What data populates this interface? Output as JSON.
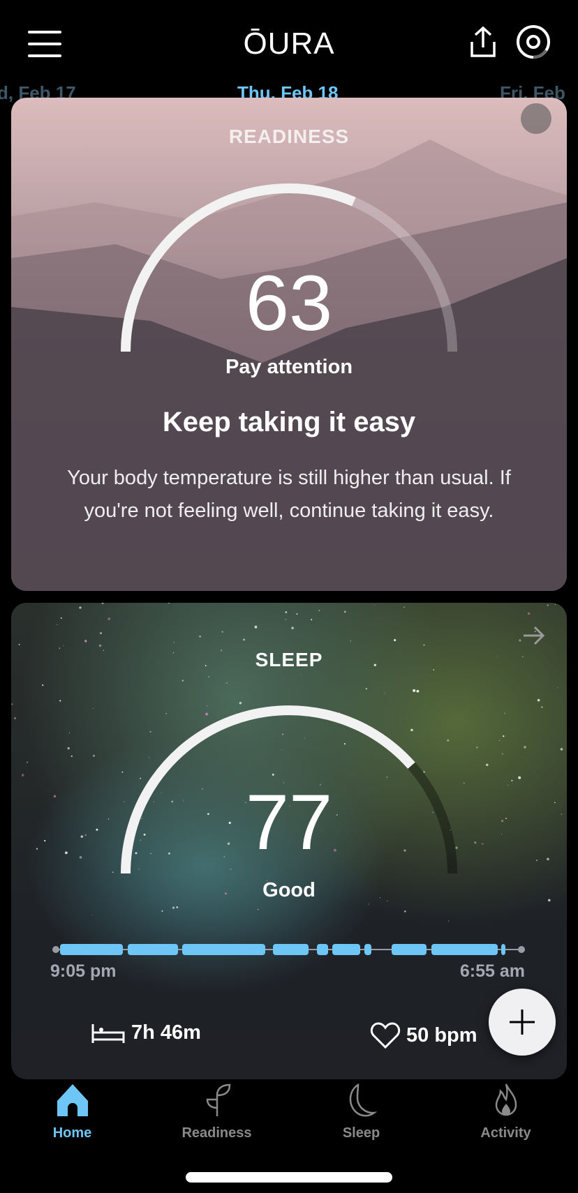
{
  "header": {
    "logo": "ŌURA",
    "menu_icon": "hamburger-icon",
    "share_icon": "share-icon",
    "ring_icon": "ring-status-icon"
  },
  "dates": {
    "prev": "d, Feb 17",
    "current": "Thu, Feb 18",
    "next": "Fri, Feb"
  },
  "colors": {
    "accent": "#6dc6f5",
    "inactive": "#8a8a8a",
    "card": "#25262b"
  },
  "readiness": {
    "title": "READINESS",
    "score": 63,
    "score_text": "63",
    "fill": 0.63,
    "label": "Pay attention",
    "headline": "Keep taking it easy",
    "body": "Your body temperature is still higher than usual. If you're not feeling well, continue taking it easy."
  },
  "sleep": {
    "title": "SLEEP",
    "score": 77,
    "score_text": "77",
    "fill": 0.77,
    "label": "Good",
    "start_time": "9:05 pm",
    "end_time": "6:55 am",
    "duration": "7h 46m",
    "heart_rate": "50 bpm"
  },
  "nav": [
    {
      "label": "Home",
      "icon": "home-icon",
      "active": true
    },
    {
      "label": "Readiness",
      "icon": "sprout-icon"
    },
    {
      "label": "Sleep",
      "icon": "moon-icon"
    },
    {
      "label": "Activity",
      "icon": "flame-icon"
    }
  ]
}
